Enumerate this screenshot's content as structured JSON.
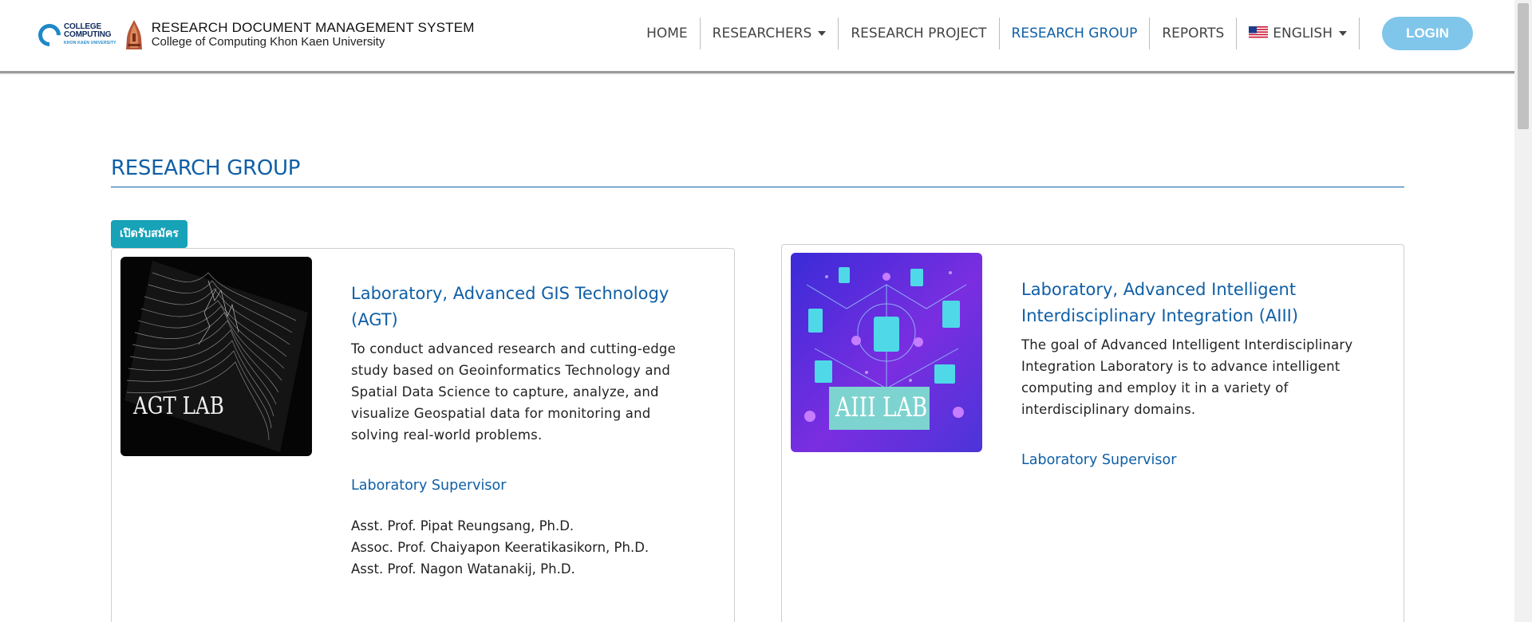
{
  "header": {
    "logo_cc": {
      "line1": "COLLEGE",
      "line2": "COMPUTING",
      "line3": "KHON KAEN UNIVERSITY"
    },
    "title": "RESEARCH DOCUMENT MANAGEMENT SYSTEM",
    "subtitle": "College of Computing Khon Kaen University",
    "nav": {
      "home": "HOME",
      "researchers": "RESEARCHERS",
      "research_project": "RESEARCH PROJECT",
      "research_group": "RESEARCH GROUP",
      "reports": "REPORTS",
      "language": "ENGLISH",
      "login": "LOGIN"
    },
    "active_nav": "research_group"
  },
  "main": {
    "page_title": "RESEARCH GROUP",
    "badge": "เปิดรับสมัคร",
    "groups": [
      {
        "image_label": "AGT LAB",
        "title": "Laboratory, Advanced GIS Technology (AGT)",
        "description": "To conduct advanced research and cutting-edge study based on Geoinformatics Technology and Spatial Data Science to capture, analyze, and visualize Geospatial data for monitoring and solving real-world problems.",
        "supervisor_heading": "Laboratory Supervisor",
        "supervisors": [
          "Asst. Prof. Pipat Reungsang, Ph.D.",
          "Assoc. Prof. Chaiyapon Keeratikasikorn, Ph.D.",
          "Asst. Prof. Nagon Watanakij, Ph.D."
        ]
      },
      {
        "image_label": "AIII LAB",
        "title": "Laboratory, Advanced Intelligent Interdisciplinary Integration (AIII)",
        "description": "The goal of Advanced Intelligent Interdisciplinary Integration Laboratory is to advance intelligent computing and employ it in a variety of interdisciplinary domains.",
        "supervisor_heading": "Laboratory Supervisor",
        "supervisors": []
      }
    ]
  },
  "colors": {
    "primary": "#0f5fa6",
    "badge": "#17a2b8",
    "login": "#7fc6ea"
  }
}
